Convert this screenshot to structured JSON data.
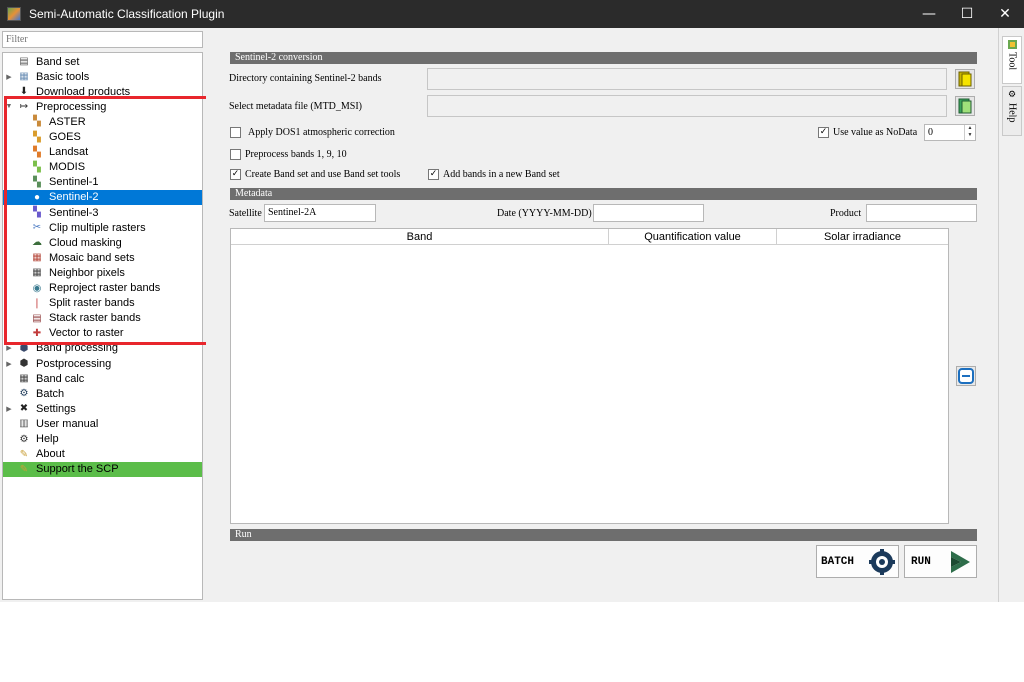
{
  "window": {
    "title": "Semi-Automatic Classification Plugin",
    "minimize": "—",
    "maximize": "☐",
    "close": "✕"
  },
  "filter": {
    "placeholder": "Filter"
  },
  "tree": [
    {
      "label": "Band set",
      "icon": "band-set-icon",
      "arrow": ""
    },
    {
      "label": "Basic tools",
      "icon": "basic-tools-icon",
      "arrow": "▶"
    },
    {
      "label": "Download products",
      "icon": "download-icon",
      "arrow": ""
    },
    {
      "label": "Preprocessing",
      "icon": "preprocessing-icon",
      "arrow": "▼"
    },
    {
      "label": "ASTER",
      "icon": "aster-icon"
    },
    {
      "label": "GOES",
      "icon": "goes-icon"
    },
    {
      "label": "Landsat",
      "icon": "landsat-icon"
    },
    {
      "label": "MODIS",
      "icon": "modis-icon"
    },
    {
      "label": "Sentinel-1",
      "icon": "sentinel1-icon"
    },
    {
      "label": "Sentinel-2",
      "icon": "sentinel2-icon"
    },
    {
      "label": "Sentinel-3",
      "icon": "sentinel3-icon"
    },
    {
      "label": "Clip multiple rasters",
      "icon": "clip-icon"
    },
    {
      "label": "Cloud masking",
      "icon": "cloud-mask-icon"
    },
    {
      "label": "Mosaic band sets",
      "icon": "mosaic-icon"
    },
    {
      "label": "Neighbor pixels",
      "icon": "neighbor-icon"
    },
    {
      "label": "Reproject raster bands",
      "icon": "reproject-icon"
    },
    {
      "label": "Split raster bands",
      "icon": "split-icon"
    },
    {
      "label": "Stack raster bands",
      "icon": "stack-icon"
    },
    {
      "label": "Vector to raster",
      "icon": "vector-raster-icon"
    },
    {
      "label": "Band processing",
      "icon": "band-processing-icon",
      "arrow": "▶"
    },
    {
      "label": "Postprocessing",
      "icon": "postprocessing-icon",
      "arrow": "▶"
    },
    {
      "label": "Band calc",
      "icon": "band-calc-icon",
      "arrow": ""
    },
    {
      "label": "Batch",
      "icon": "batch-icon",
      "arrow": ""
    },
    {
      "label": "Settings",
      "icon": "settings-icon",
      "arrow": "▶"
    },
    {
      "label": "User manual",
      "icon": "manual-icon",
      "arrow": ""
    },
    {
      "label": "Help",
      "icon": "help-icon",
      "arrow": ""
    },
    {
      "label": "About",
      "icon": "about-icon",
      "arrow": ""
    },
    {
      "label": "Support the SCP",
      "icon": "support-icon",
      "arrow": ""
    }
  ],
  "conversion": {
    "header": "Sentinel-2 conversion",
    "dir_label": "Directory containing Sentinel-2 bands",
    "dir_value": "",
    "meta_label": "Select metadata file (MTD_MSI)",
    "meta_value": "",
    "dos1_label": "Apply DOS1 atmospheric correction",
    "dos1_checked": "",
    "nodata_label": "Use value as NoData",
    "nodata_checked": "✓",
    "nodata_value": "0",
    "preprocess_label": "Preprocess bands 1, 9, 10",
    "preprocess_checked": "",
    "create_bandset_label": "Create Band set and use Band set tools",
    "create_bandset_checked": "✓",
    "add_bands_label": "Add bands in a new Band set",
    "add_bands_checked": "✓"
  },
  "metadata": {
    "header": "Metadata",
    "satellite_label": "Satellite",
    "satellite_value": "Sentinel-2A",
    "date_label": "Date (YYYY-MM-DD)",
    "date_value": "",
    "product_label": "Product",
    "product_value": ""
  },
  "table": {
    "columns": [
      "Band",
      "Quantification value",
      "Solar irradiance"
    ]
  },
  "run": {
    "header": "Run",
    "batch_label": "BATCH",
    "run_label": "RUN"
  },
  "side_tabs": {
    "tool": "Tool",
    "help": "Help"
  }
}
